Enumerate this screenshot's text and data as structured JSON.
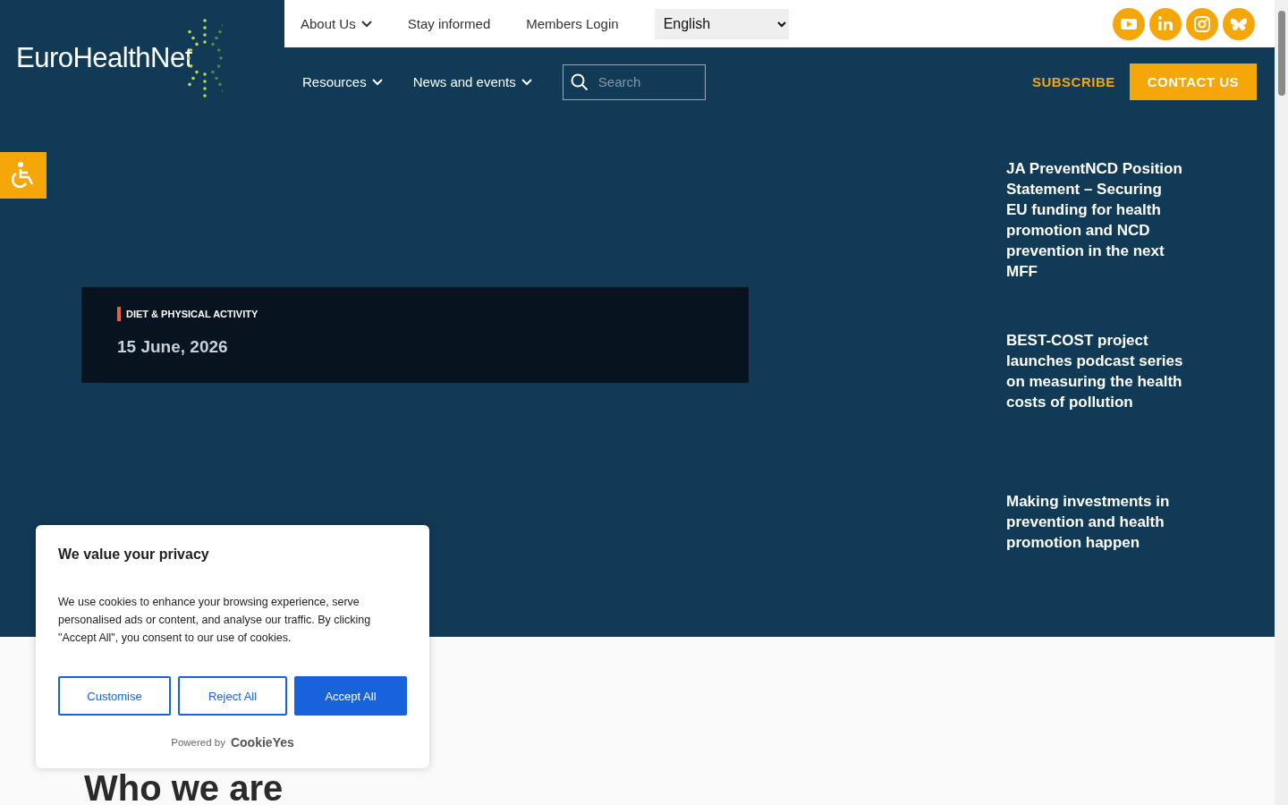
{
  "logo": {
    "text": "EuroHealthNet"
  },
  "top_nav": [
    {
      "label": "About Us",
      "dropdown": true
    },
    {
      "label": "Stay informed",
      "dropdown": false
    },
    {
      "label": "Members Login",
      "dropdown": false
    }
  ],
  "language_select": {
    "value": "English"
  },
  "social": [
    {
      "kind": "youtube"
    },
    {
      "kind": "linkedin"
    },
    {
      "kind": "instagram"
    },
    {
      "kind": "bluesky"
    }
  ],
  "main_nav": [
    {
      "label": "Resources",
      "dropdown": true
    },
    {
      "label": "News and events",
      "dropdown": true
    }
  ],
  "search": {
    "placeholder": "Search"
  },
  "subscribe": "SUBSCRIBE",
  "contact": "CONTACT US",
  "feature": {
    "category": "DIET & PHYSICAL ACTIVITY",
    "date": "15 June, 2026"
  },
  "news": [
    "JA PreventNCD Position Statement – Securing EU funding for health promotion and NCD prevention in the next MFF",
    "BEST-COST project launches podcast series on measuring the health costs of pollution",
    "Making investments in prevention and health promotion happen"
  ],
  "section_heading": "Who we are",
  "cookie_dialog": {
    "title": "We value your privacy",
    "body": "We use cookies to enhance your browsing experience, serve personalised ads or content, and analyse our traffic. By clicking \"Accept All\", you consent to our use of cookies.",
    "buttons": [
      {
        "label": "Customise",
        "primary": false
      },
      {
        "label": "Reject All",
        "primary": false
      },
      {
        "label": "Accept All",
        "primary": true
      }
    ],
    "powered_by": "Powered by",
    "brand": "CookieYes"
  }
}
